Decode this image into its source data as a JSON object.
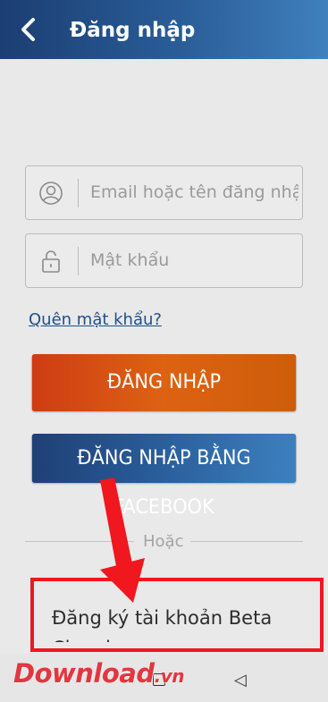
{
  "header": {
    "title": "Đăng nhập",
    "back_icon": "chevron-left-icon"
  },
  "form": {
    "email": {
      "placeholder": "Email hoặc tên đăng nhập",
      "icon": "user-icon"
    },
    "password": {
      "placeholder": "Mật khẩu",
      "icon": "lock-icon"
    },
    "forgot_link": "Quên mật khẩu?",
    "login_button": "ĐĂNG NHẬP",
    "facebook_button": "ĐĂNG NHẬP BẰNG FACEBOOK",
    "or_text": "Hoặc",
    "register_link": "Đăng ký tài khoản Beta Cineplex"
  },
  "watermark": {
    "brand": "Download",
    "tld": ".vn"
  },
  "colors": {
    "header": "#2a5d98",
    "login_button": "#dd6212",
    "facebook_button": "#2a5f9c",
    "link": "#1e4f8c",
    "highlight": "#f0171f"
  }
}
